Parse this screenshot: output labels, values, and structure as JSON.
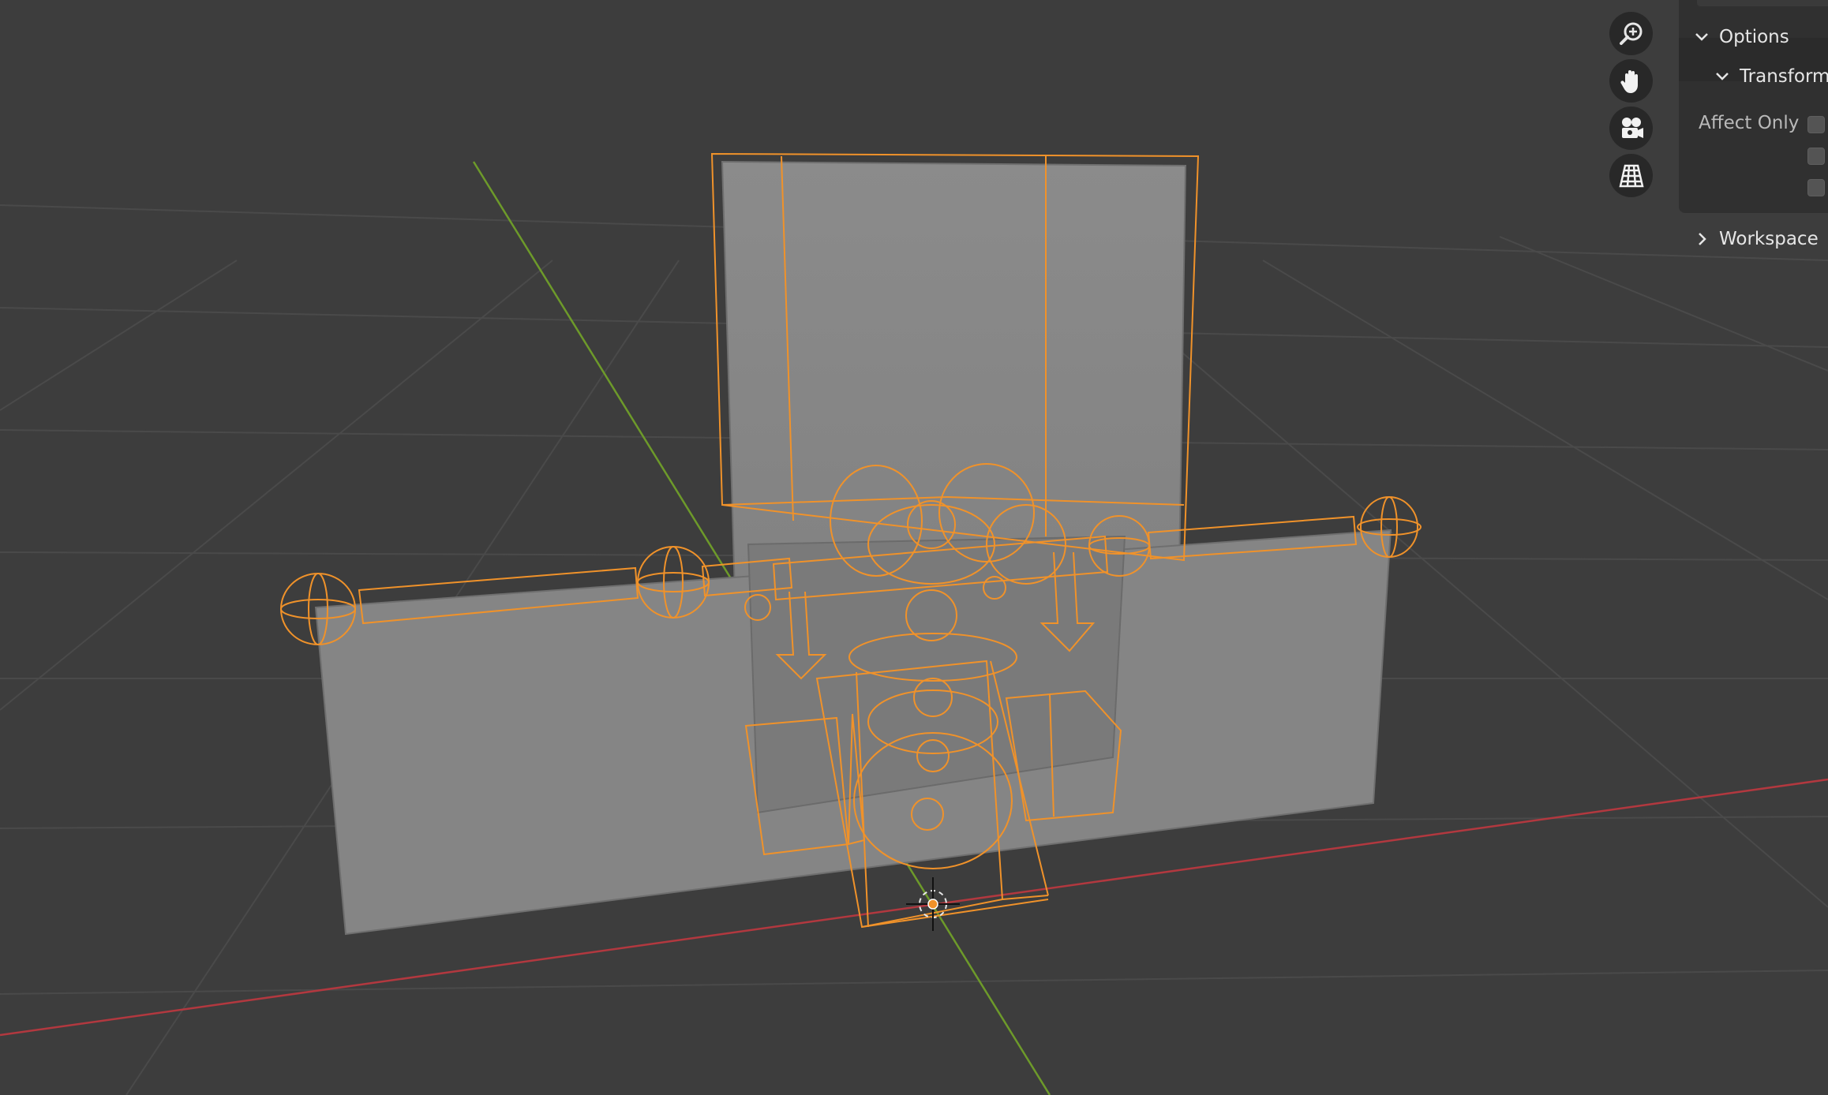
{
  "viewport": {
    "background": "#3d3d3d",
    "grid_color": "#474747",
    "x_axis_color": "#b2383f",
    "y_axis_color": "#6d9a2a",
    "selection_color": "#f0922a",
    "mesh_color": "#8a8a8a"
  },
  "nav_gizmo": {
    "buttons": [
      {
        "icon": "zoom-icon"
      },
      {
        "icon": "hand-pan-icon"
      },
      {
        "icon": "camera-icon"
      },
      {
        "icon": "perspective-grid-icon"
      }
    ]
  },
  "panel": {
    "options_label": "Options",
    "transform_label": "Transform",
    "affect_only_label": "Affect Only",
    "checkboxes": [
      false,
      false,
      false
    ],
    "workspace_label": "Workspace"
  }
}
